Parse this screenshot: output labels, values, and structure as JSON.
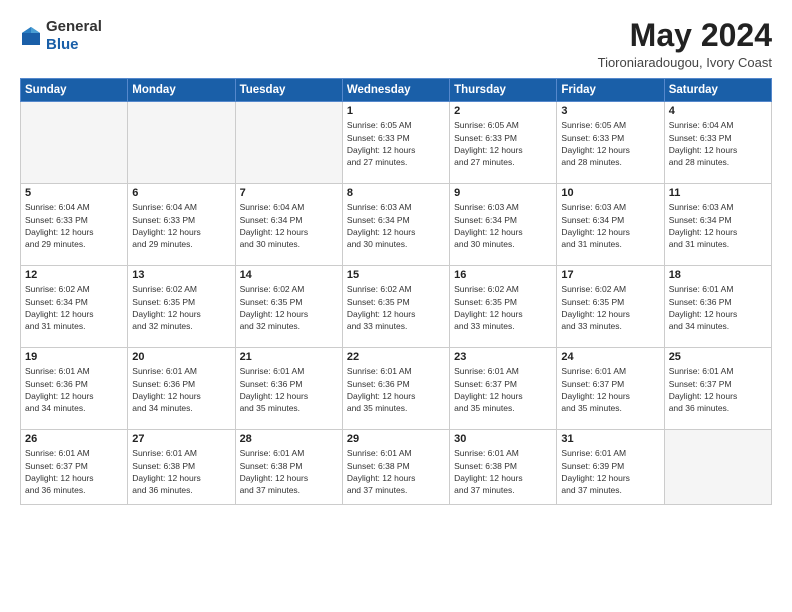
{
  "header": {
    "logo": {
      "general": "General",
      "blue": "Blue"
    },
    "title": "May 2024",
    "location": "Tioroniaradougou, Ivory Coast"
  },
  "weekdays": [
    "Sunday",
    "Monday",
    "Tuesday",
    "Wednesday",
    "Thursday",
    "Friday",
    "Saturday"
  ],
  "weeks": [
    [
      {
        "day": "",
        "info": ""
      },
      {
        "day": "",
        "info": ""
      },
      {
        "day": "",
        "info": ""
      },
      {
        "day": "1",
        "info": "Sunrise: 6:05 AM\nSunset: 6:33 PM\nDaylight: 12 hours\nand 27 minutes."
      },
      {
        "day": "2",
        "info": "Sunrise: 6:05 AM\nSunset: 6:33 PM\nDaylight: 12 hours\nand 27 minutes."
      },
      {
        "day": "3",
        "info": "Sunrise: 6:05 AM\nSunset: 6:33 PM\nDaylight: 12 hours\nand 28 minutes."
      },
      {
        "day": "4",
        "info": "Sunrise: 6:04 AM\nSunset: 6:33 PM\nDaylight: 12 hours\nand 28 minutes."
      }
    ],
    [
      {
        "day": "5",
        "info": "Sunrise: 6:04 AM\nSunset: 6:33 PM\nDaylight: 12 hours\nand 29 minutes."
      },
      {
        "day": "6",
        "info": "Sunrise: 6:04 AM\nSunset: 6:33 PM\nDaylight: 12 hours\nand 29 minutes."
      },
      {
        "day": "7",
        "info": "Sunrise: 6:04 AM\nSunset: 6:34 PM\nDaylight: 12 hours\nand 30 minutes."
      },
      {
        "day": "8",
        "info": "Sunrise: 6:03 AM\nSunset: 6:34 PM\nDaylight: 12 hours\nand 30 minutes."
      },
      {
        "day": "9",
        "info": "Sunrise: 6:03 AM\nSunset: 6:34 PM\nDaylight: 12 hours\nand 30 minutes."
      },
      {
        "day": "10",
        "info": "Sunrise: 6:03 AM\nSunset: 6:34 PM\nDaylight: 12 hours\nand 31 minutes."
      },
      {
        "day": "11",
        "info": "Sunrise: 6:03 AM\nSunset: 6:34 PM\nDaylight: 12 hours\nand 31 minutes."
      }
    ],
    [
      {
        "day": "12",
        "info": "Sunrise: 6:02 AM\nSunset: 6:34 PM\nDaylight: 12 hours\nand 31 minutes."
      },
      {
        "day": "13",
        "info": "Sunrise: 6:02 AM\nSunset: 6:35 PM\nDaylight: 12 hours\nand 32 minutes."
      },
      {
        "day": "14",
        "info": "Sunrise: 6:02 AM\nSunset: 6:35 PM\nDaylight: 12 hours\nand 32 minutes."
      },
      {
        "day": "15",
        "info": "Sunrise: 6:02 AM\nSunset: 6:35 PM\nDaylight: 12 hours\nand 33 minutes."
      },
      {
        "day": "16",
        "info": "Sunrise: 6:02 AM\nSunset: 6:35 PM\nDaylight: 12 hours\nand 33 minutes."
      },
      {
        "day": "17",
        "info": "Sunrise: 6:02 AM\nSunset: 6:35 PM\nDaylight: 12 hours\nand 33 minutes."
      },
      {
        "day": "18",
        "info": "Sunrise: 6:01 AM\nSunset: 6:36 PM\nDaylight: 12 hours\nand 34 minutes."
      }
    ],
    [
      {
        "day": "19",
        "info": "Sunrise: 6:01 AM\nSunset: 6:36 PM\nDaylight: 12 hours\nand 34 minutes."
      },
      {
        "day": "20",
        "info": "Sunrise: 6:01 AM\nSunset: 6:36 PM\nDaylight: 12 hours\nand 34 minutes."
      },
      {
        "day": "21",
        "info": "Sunrise: 6:01 AM\nSunset: 6:36 PM\nDaylight: 12 hours\nand 35 minutes."
      },
      {
        "day": "22",
        "info": "Sunrise: 6:01 AM\nSunset: 6:36 PM\nDaylight: 12 hours\nand 35 minutes."
      },
      {
        "day": "23",
        "info": "Sunrise: 6:01 AM\nSunset: 6:37 PM\nDaylight: 12 hours\nand 35 minutes."
      },
      {
        "day": "24",
        "info": "Sunrise: 6:01 AM\nSunset: 6:37 PM\nDaylight: 12 hours\nand 35 minutes."
      },
      {
        "day": "25",
        "info": "Sunrise: 6:01 AM\nSunset: 6:37 PM\nDaylight: 12 hours\nand 36 minutes."
      }
    ],
    [
      {
        "day": "26",
        "info": "Sunrise: 6:01 AM\nSunset: 6:37 PM\nDaylight: 12 hours\nand 36 minutes."
      },
      {
        "day": "27",
        "info": "Sunrise: 6:01 AM\nSunset: 6:38 PM\nDaylight: 12 hours\nand 36 minutes."
      },
      {
        "day": "28",
        "info": "Sunrise: 6:01 AM\nSunset: 6:38 PM\nDaylight: 12 hours\nand 37 minutes."
      },
      {
        "day": "29",
        "info": "Sunrise: 6:01 AM\nSunset: 6:38 PM\nDaylight: 12 hours\nand 37 minutes."
      },
      {
        "day": "30",
        "info": "Sunrise: 6:01 AM\nSunset: 6:38 PM\nDaylight: 12 hours\nand 37 minutes."
      },
      {
        "day": "31",
        "info": "Sunrise: 6:01 AM\nSunset: 6:39 PM\nDaylight: 12 hours\nand 37 minutes."
      },
      {
        "day": "",
        "info": ""
      }
    ]
  ]
}
